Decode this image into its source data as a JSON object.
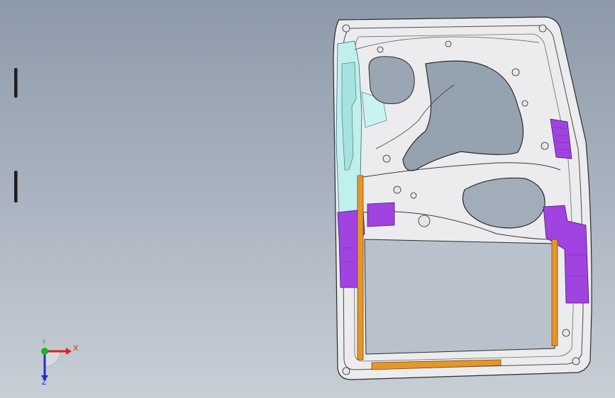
{
  "viewport": {
    "background_top": "#8d9aa9",
    "background_bottom": "#c8ced6"
  },
  "model": {
    "name_icon": "car-door-inner-panel",
    "colors": {
      "panel_fill": "#ececef",
      "panel_edge": "#2b2b2b",
      "reinforcement_cyan": "#bff0ee",
      "bracket_purple": "#a043e0",
      "rail_orange": "#e6962a"
    }
  },
  "triad": {
    "x_label": "X",
    "y_label": "Y",
    "z_label": "Z",
    "x_color": "#e02020",
    "y_color": "#20b020",
    "z_color": "#2030d0"
  }
}
